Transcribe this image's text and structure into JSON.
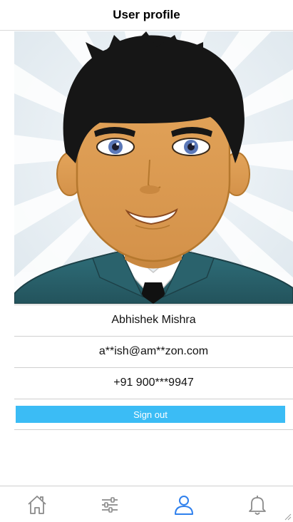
{
  "header": {
    "title": "User profile"
  },
  "profile": {
    "avatar_icon": "cartoon-man-avatar",
    "name": "Abhishek Mishra",
    "email": "a**ish@am**zon.com",
    "phone": "+91 900***9947"
  },
  "actions": {
    "sign_out_label": "Sign out"
  },
  "tabbar": {
    "items": [
      {
        "icon": "home-icon",
        "active": false
      },
      {
        "icon": "sliders-icon",
        "active": false
      },
      {
        "icon": "user-icon",
        "active": true
      },
      {
        "icon": "bell-icon",
        "active": false
      }
    ]
  },
  "colors": {
    "accent": "#3bbcf5",
    "active_tab": "#2f80ed",
    "inactive_tab": "#8a8a8a",
    "divider": "#cfcfcf"
  }
}
